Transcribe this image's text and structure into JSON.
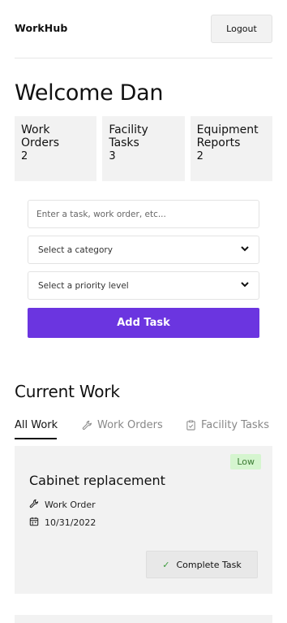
{
  "header": {
    "brand": "WorkHub",
    "logout_label": "Logout"
  },
  "welcome": "Welcome Dan",
  "stats": [
    {
      "label": "Work Orders",
      "count": "2"
    },
    {
      "label": "Facility Tasks",
      "count": "3"
    },
    {
      "label": "Equipment Reports",
      "count": "2"
    }
  ],
  "form": {
    "task_placeholder": "Enter a task, work order, etc...",
    "category_placeholder": "Select a category",
    "priority_placeholder": "Select a priority level",
    "add_label": "Add Task"
  },
  "current_work": {
    "title": "Current Work",
    "tabs": [
      {
        "label": "All Work",
        "icon": "none"
      },
      {
        "label": "Work Orders",
        "icon": "wrench-icon"
      },
      {
        "label": "Facility Tasks",
        "icon": "clipboard-check-icon"
      }
    ]
  },
  "cards": [
    {
      "badge": "Low",
      "title": "Cabinet replacement",
      "type": "Work Order",
      "date": "10/31/2022",
      "action_label": "Complete Task"
    }
  ],
  "colors": {
    "accent": "#6b35e0",
    "badge_bg": "#d5f5cf",
    "badge_text": "#3a7a32",
    "card_bg": "#f2f2f2"
  }
}
